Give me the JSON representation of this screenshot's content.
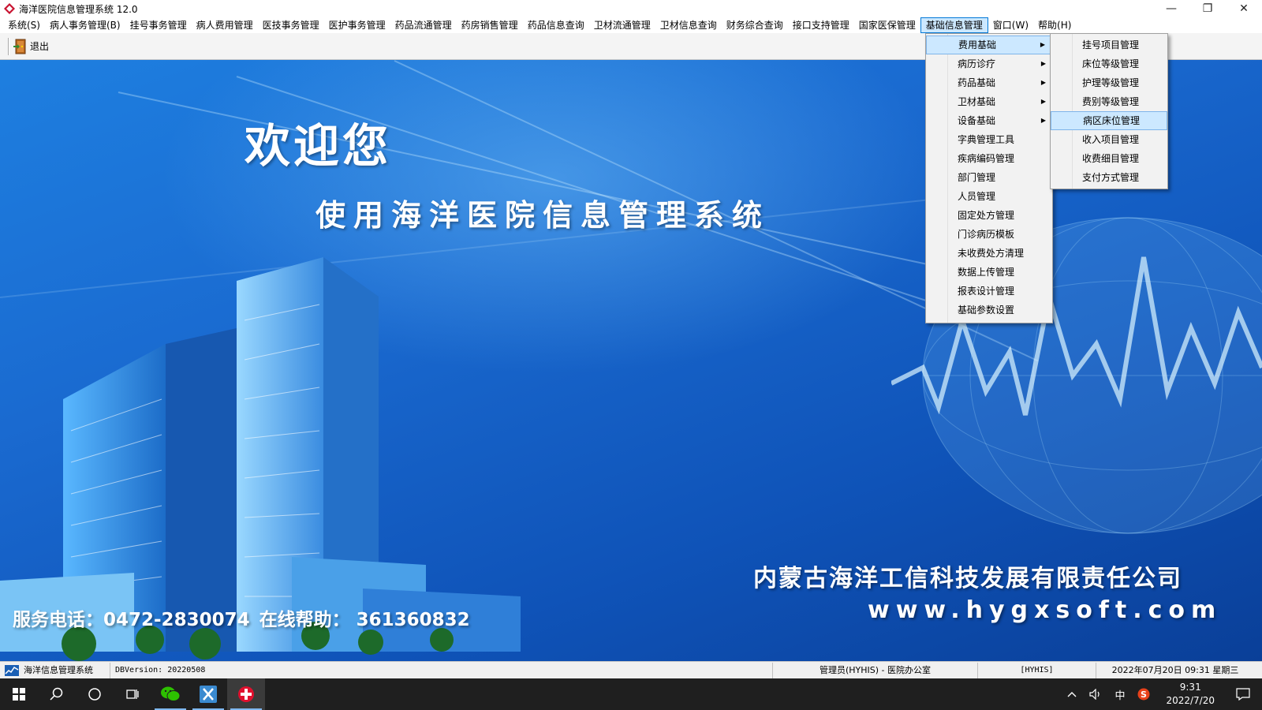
{
  "window": {
    "title": "海洋医院信息管理系统 12.0",
    "controls": {
      "minimize": "—",
      "restore": "❐",
      "close": "✕"
    }
  },
  "menubar": {
    "items": [
      "系统(S)",
      "病人事务管理(B)",
      "挂号事务管理",
      "病人费用管理",
      "医技事务管理",
      "医护事务管理",
      "药品流通管理",
      "药房销售管理",
      "药品信息查询",
      "卫材流通管理",
      "卫材信息查询",
      "财务综合查询",
      "接口支持管理",
      "国家医保管理",
      "基础信息管理",
      "窗口(W)",
      "帮助(H)"
    ],
    "active_index": 14
  },
  "toolbar": {
    "exit_label": "退出"
  },
  "splash": {
    "welcome": "欢迎您",
    "subtitle": "使用海洋医院信息管理系统",
    "company": "内蒙古海洋工信科技发展有限责任公司",
    "website": "www.hygxsoft.com",
    "service_phone": "服务电话：0472-2830074",
    "online_help": "在线帮助：  361360832"
  },
  "menu_basic_info": {
    "items": [
      {
        "label": "费用基础",
        "submenu": true
      },
      {
        "label": "病历诊疗",
        "submenu": true
      },
      {
        "label": "药品基础",
        "submenu": true
      },
      {
        "label": "卫材基础",
        "submenu": true
      },
      {
        "label": "设备基础",
        "submenu": true
      },
      {
        "label": "字典管理工具",
        "submenu": false
      },
      {
        "label": "疾病编码管理",
        "submenu": false
      },
      {
        "label": "部门管理",
        "submenu": false
      },
      {
        "label": "人员管理",
        "submenu": false
      },
      {
        "label": "固定处方管理",
        "submenu": false
      },
      {
        "label": "门诊病历模板",
        "submenu": false
      },
      {
        "label": "未收费处方清理",
        "submenu": false
      },
      {
        "label": "数据上传管理",
        "submenu": false
      },
      {
        "label": "报表设计管理",
        "submenu": false
      },
      {
        "label": "基础参数设置",
        "submenu": false
      }
    ],
    "highlighted_index": 0
  },
  "menu_fee_basis": {
    "items": [
      "挂号项目管理",
      "床位等级管理",
      "护理等级管理",
      "费别等级管理",
      "病区床位管理",
      "收入项目管理",
      "收费细目管理",
      "支付方式管理"
    ],
    "highlighted_index": 4
  },
  "statusbar": {
    "app_name": "海洋信息管理系统",
    "db_version": "DBVersion: 20220508",
    "user": "管理员(HYHIS) - 医院办公室",
    "code": "[HYHIS]",
    "datetime": "2022年07月20日 09:31 星期三"
  },
  "taskbar": {
    "time": "9:31",
    "date": "2022/7/20",
    "ime": "中"
  },
  "colors": {
    "menu_highlight": "#cce8ff",
    "menu_border": "#0078d7",
    "splash_blue": "#1a6ad0",
    "taskbar": "#1f1f1f"
  }
}
